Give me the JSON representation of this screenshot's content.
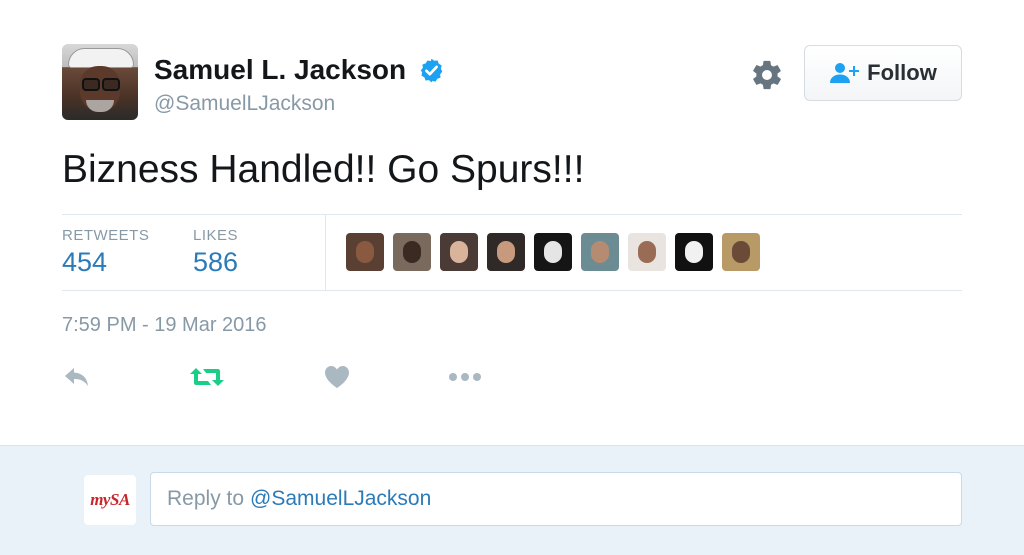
{
  "author": {
    "name": "Samuel L. Jackson",
    "handle": "@SamuelLJackson",
    "verified": true,
    "avatar_icon": "user-avatar"
  },
  "header": {
    "settings_icon": "gear-icon",
    "follow_label": "Follow",
    "follow_icon": "add-user-icon"
  },
  "tweet": {
    "text": "Bizness Handled!! Go Spurs!!!",
    "timestamp": "7:59 PM - 19 Mar 2016"
  },
  "stats": {
    "retweets_label": "RETWEETS",
    "retweets_value": "454",
    "likes_label": "LIKES",
    "likes_value": "586"
  },
  "likers": [
    {
      "bg": "#5a3f33",
      "face": "#8a5a40"
    },
    {
      "bg": "#7a6a5e",
      "face": "#3b2a22"
    },
    {
      "bg": "#4a3b36",
      "face": "#d9b39a"
    },
    {
      "bg": "#2f2a28",
      "face": "#c79a7e"
    },
    {
      "bg": "#151515",
      "face": "#e5e5e5"
    },
    {
      "bg": "#6c8c94",
      "face": "#b58c72"
    },
    {
      "bg": "#e9e4e0",
      "face": "#9a6b55"
    },
    {
      "bg": "#111111",
      "face": "#f1f1f1"
    },
    {
      "bg": "#b79a66",
      "face": "#6b4a38"
    }
  ],
  "actions": {
    "reply_icon": "reply-icon",
    "retweet_icon": "retweet-icon",
    "like_icon": "heart-icon",
    "more_icon": "more-icon",
    "retweet_active_color": "#19cf86",
    "icon_color": "#aab8c2"
  },
  "reply": {
    "prefix": "Reply to",
    "mention": "@SamuelLJackson",
    "viewer_logo_text_my": "my",
    "viewer_logo_text_sa": "SA"
  },
  "colors": {
    "link": "#2b7bb9",
    "muted": "#8899a6",
    "verified": "#1da1f2",
    "reply_bg": "#e8f2f8"
  }
}
